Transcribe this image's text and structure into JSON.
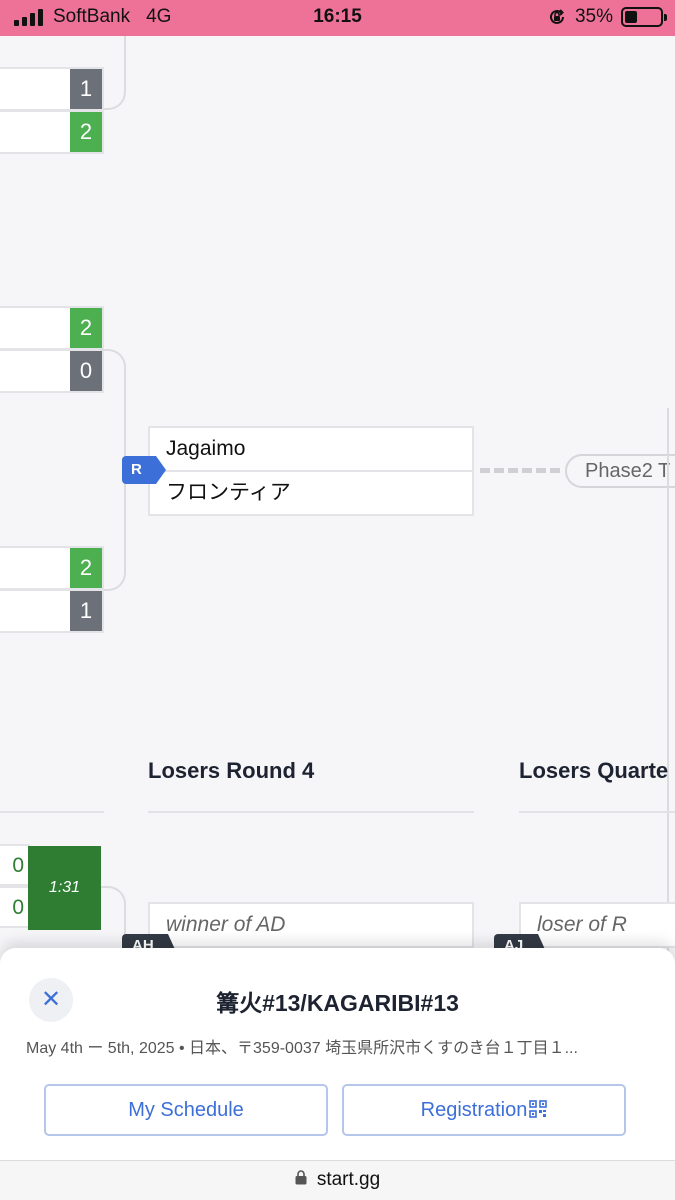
{
  "status_bar": {
    "carrier": "SoftBank",
    "network": "4G",
    "time": "16:15",
    "battery": "35%",
    "battery_level": 0.35
  },
  "bracket": {
    "upper_matches": [
      {
        "scores": [
          "1",
          "2"
        ],
        "winner_index": 1
      },
      {
        "scores": [
          "2",
          "0"
        ],
        "winner_index": 0
      },
      {
        "scores": [
          "2",
          "1"
        ],
        "winner_index": 0
      }
    ],
    "match_r": {
      "tag": "R",
      "player1": "Jagaimo",
      "player2": "フロンティア",
      "next_label": "Phase2 T"
    },
    "losers_round_4": {
      "title": "Losers Round 4",
      "slot_text": "winner of AD",
      "tag": "AH"
    },
    "losers_quarter": {
      "title": "Losers Quarte",
      "slot_text": "loser of R",
      "tag": "AJ"
    },
    "live_match": {
      "scores": [
        "0",
        "0"
      ],
      "timer": "1:31"
    }
  },
  "sheet": {
    "close_label": "✕",
    "event_title": "篝火#13/KAGARIBI#13",
    "event_meta": "May 4th ー 5th, 2025 • 日本、〒359-0037 埼玉県所沢市くすのき台１丁目１...",
    "my_schedule_label": "My Schedule",
    "registration_label": "Registration"
  },
  "url_bar": {
    "domain": "start.gg"
  },
  "colors": {
    "status_bar_bg": "#ee7298",
    "win": "#4caf50",
    "lose": "#6c7079",
    "accent": "#3c6fd8",
    "live": "#2e7d32"
  },
  "icons": {
    "signal": "cell-signal-icon",
    "rotation_lock": "rotation-lock-icon",
    "battery": "battery-icon",
    "close": "close-icon",
    "qr": "qr-code-icon",
    "lock": "lock-icon"
  }
}
